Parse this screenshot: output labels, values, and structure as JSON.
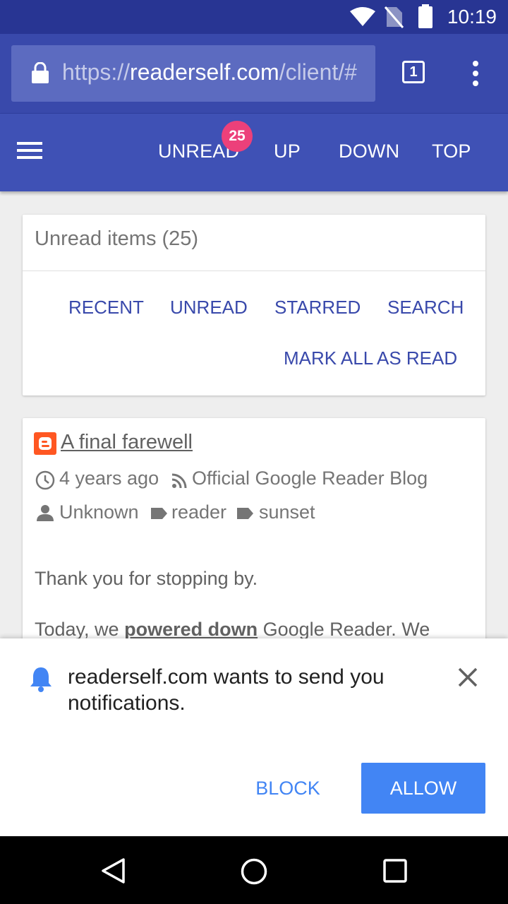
{
  "status_bar": {
    "time": "10:19",
    "icons": [
      "wifi-icon",
      "no-sim-icon",
      "battery-icon"
    ]
  },
  "browser": {
    "url_prefix": "https://",
    "url_host": "readerself.com",
    "url_path": "/client/#",
    "tab_count": "1"
  },
  "toolbar": {
    "unread_label": "UNREAD",
    "unread_badge": "25",
    "up_label": "UP",
    "down_label": "DOWN",
    "top_label": "TOP"
  },
  "summary_card": {
    "title": "Unread items (25)",
    "actions": [
      "RECENT",
      "UNREAD",
      "STARRED",
      "SEARCH"
    ],
    "mark_all": "MARK ALL AS READ"
  },
  "article": {
    "title": "A final farewell",
    "time_ago": "4 years ago",
    "feed": "Official Google Reader Blog",
    "author": "Unknown",
    "tags": [
      "reader",
      "sunset"
    ],
    "paragraph1": "Thank you for stopping by.",
    "paragraph2_start": "Today, we ",
    "paragraph2_link": "powered down",
    "paragraph2_end": " Google Reader. We"
  },
  "notification": {
    "message": "readerself.com wants to send you notifications.",
    "block_label": "BLOCK",
    "allow_label": "ALLOW"
  },
  "colors": {
    "status_bar": "#283593",
    "url_bar": "#3949ab",
    "app_bar": "#3f51b5",
    "badge": "#ec407a",
    "accent": "#4285f4"
  }
}
